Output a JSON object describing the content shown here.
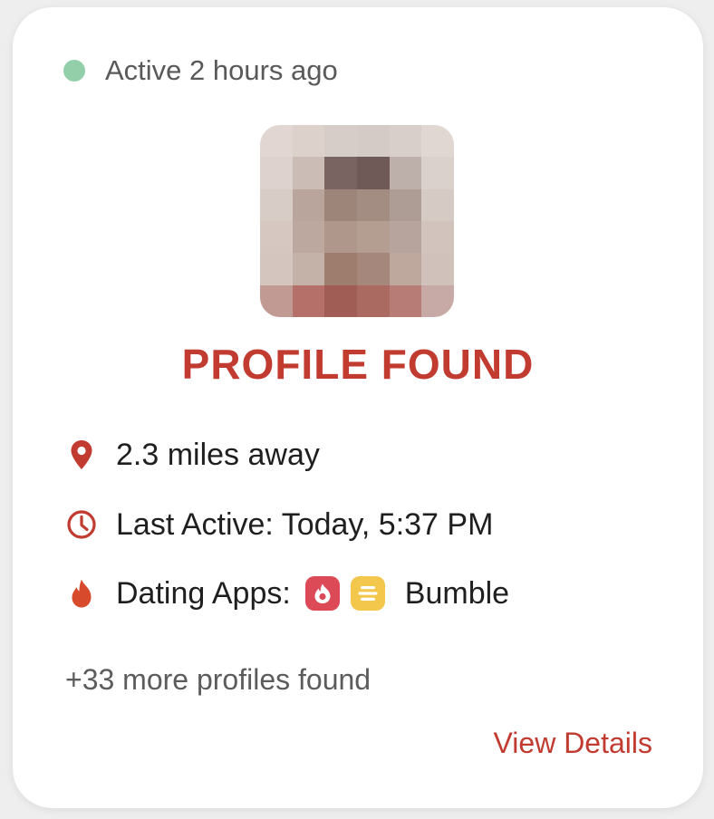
{
  "status": {
    "text": "Active 2 hours ago",
    "dot_color": "#93cfa9"
  },
  "profile": {
    "avatar_icon": "pixelated-avatar",
    "headline": "PROFILE FOUND",
    "accent_color": "#c23b30"
  },
  "details": {
    "distance": "2.3 miles away",
    "last_active": "Last Active: Today, 5:37 PM",
    "dating_apps_label": "Dating Apps:",
    "apps": [
      "tinder",
      "bumble"
    ],
    "app_name": "Bumble"
  },
  "footer": {
    "more_profiles": "+33 more profiles found",
    "view_details": "View Details"
  }
}
